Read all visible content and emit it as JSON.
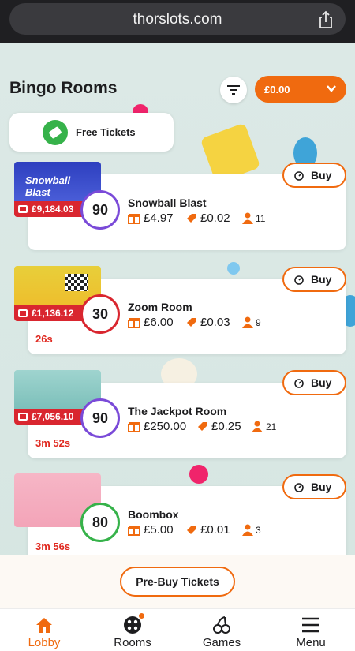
{
  "browser": {
    "url": "thorslots.com"
  },
  "header": {
    "title": "Bingo Rooms",
    "balance": "£0.00",
    "free_tickets": "Free Tickets"
  },
  "rooms": [
    {
      "name": "Snowball Blast",
      "ball": "90",
      "jackpot": "£9,184.03",
      "prize": "£4.97",
      "ticket": "£0.02",
      "players": "11",
      "timer": "",
      "buy": "Buy",
      "thumb_text": "Snowball Blast"
    },
    {
      "name": "Zoom Room",
      "ball": "30",
      "jackpot": "£1,136.12",
      "prize": "£6.00",
      "ticket": "£0.03",
      "players": "9",
      "timer": "26s",
      "buy": "Buy"
    },
    {
      "name": "The Jackpot Room",
      "ball": "90",
      "jackpot": "£7,056.10",
      "prize": "£250.00",
      "ticket": "£0.25",
      "players": "21",
      "timer": "3m 52s",
      "buy": "Buy"
    },
    {
      "name": "Boombox",
      "ball": "80",
      "jackpot": "",
      "prize": "£5.00",
      "ticket": "£0.01",
      "players": "3",
      "timer": "3m 56s",
      "buy": "Buy"
    }
  ],
  "prebuy": "Pre-Buy Tickets",
  "nav": [
    {
      "label": "Lobby",
      "icon": "home-icon"
    },
    {
      "label": "Rooms",
      "icon": "bingo-ball-icon"
    },
    {
      "label": "Games",
      "icon": "cherries-icon"
    },
    {
      "label": "Menu",
      "icon": "hamburger-icon"
    }
  ],
  "colors": {
    "accent": "#f06a0f",
    "jackpot": "#d9262f",
    "timer": "#e0281f",
    "green": "#36b24a"
  }
}
